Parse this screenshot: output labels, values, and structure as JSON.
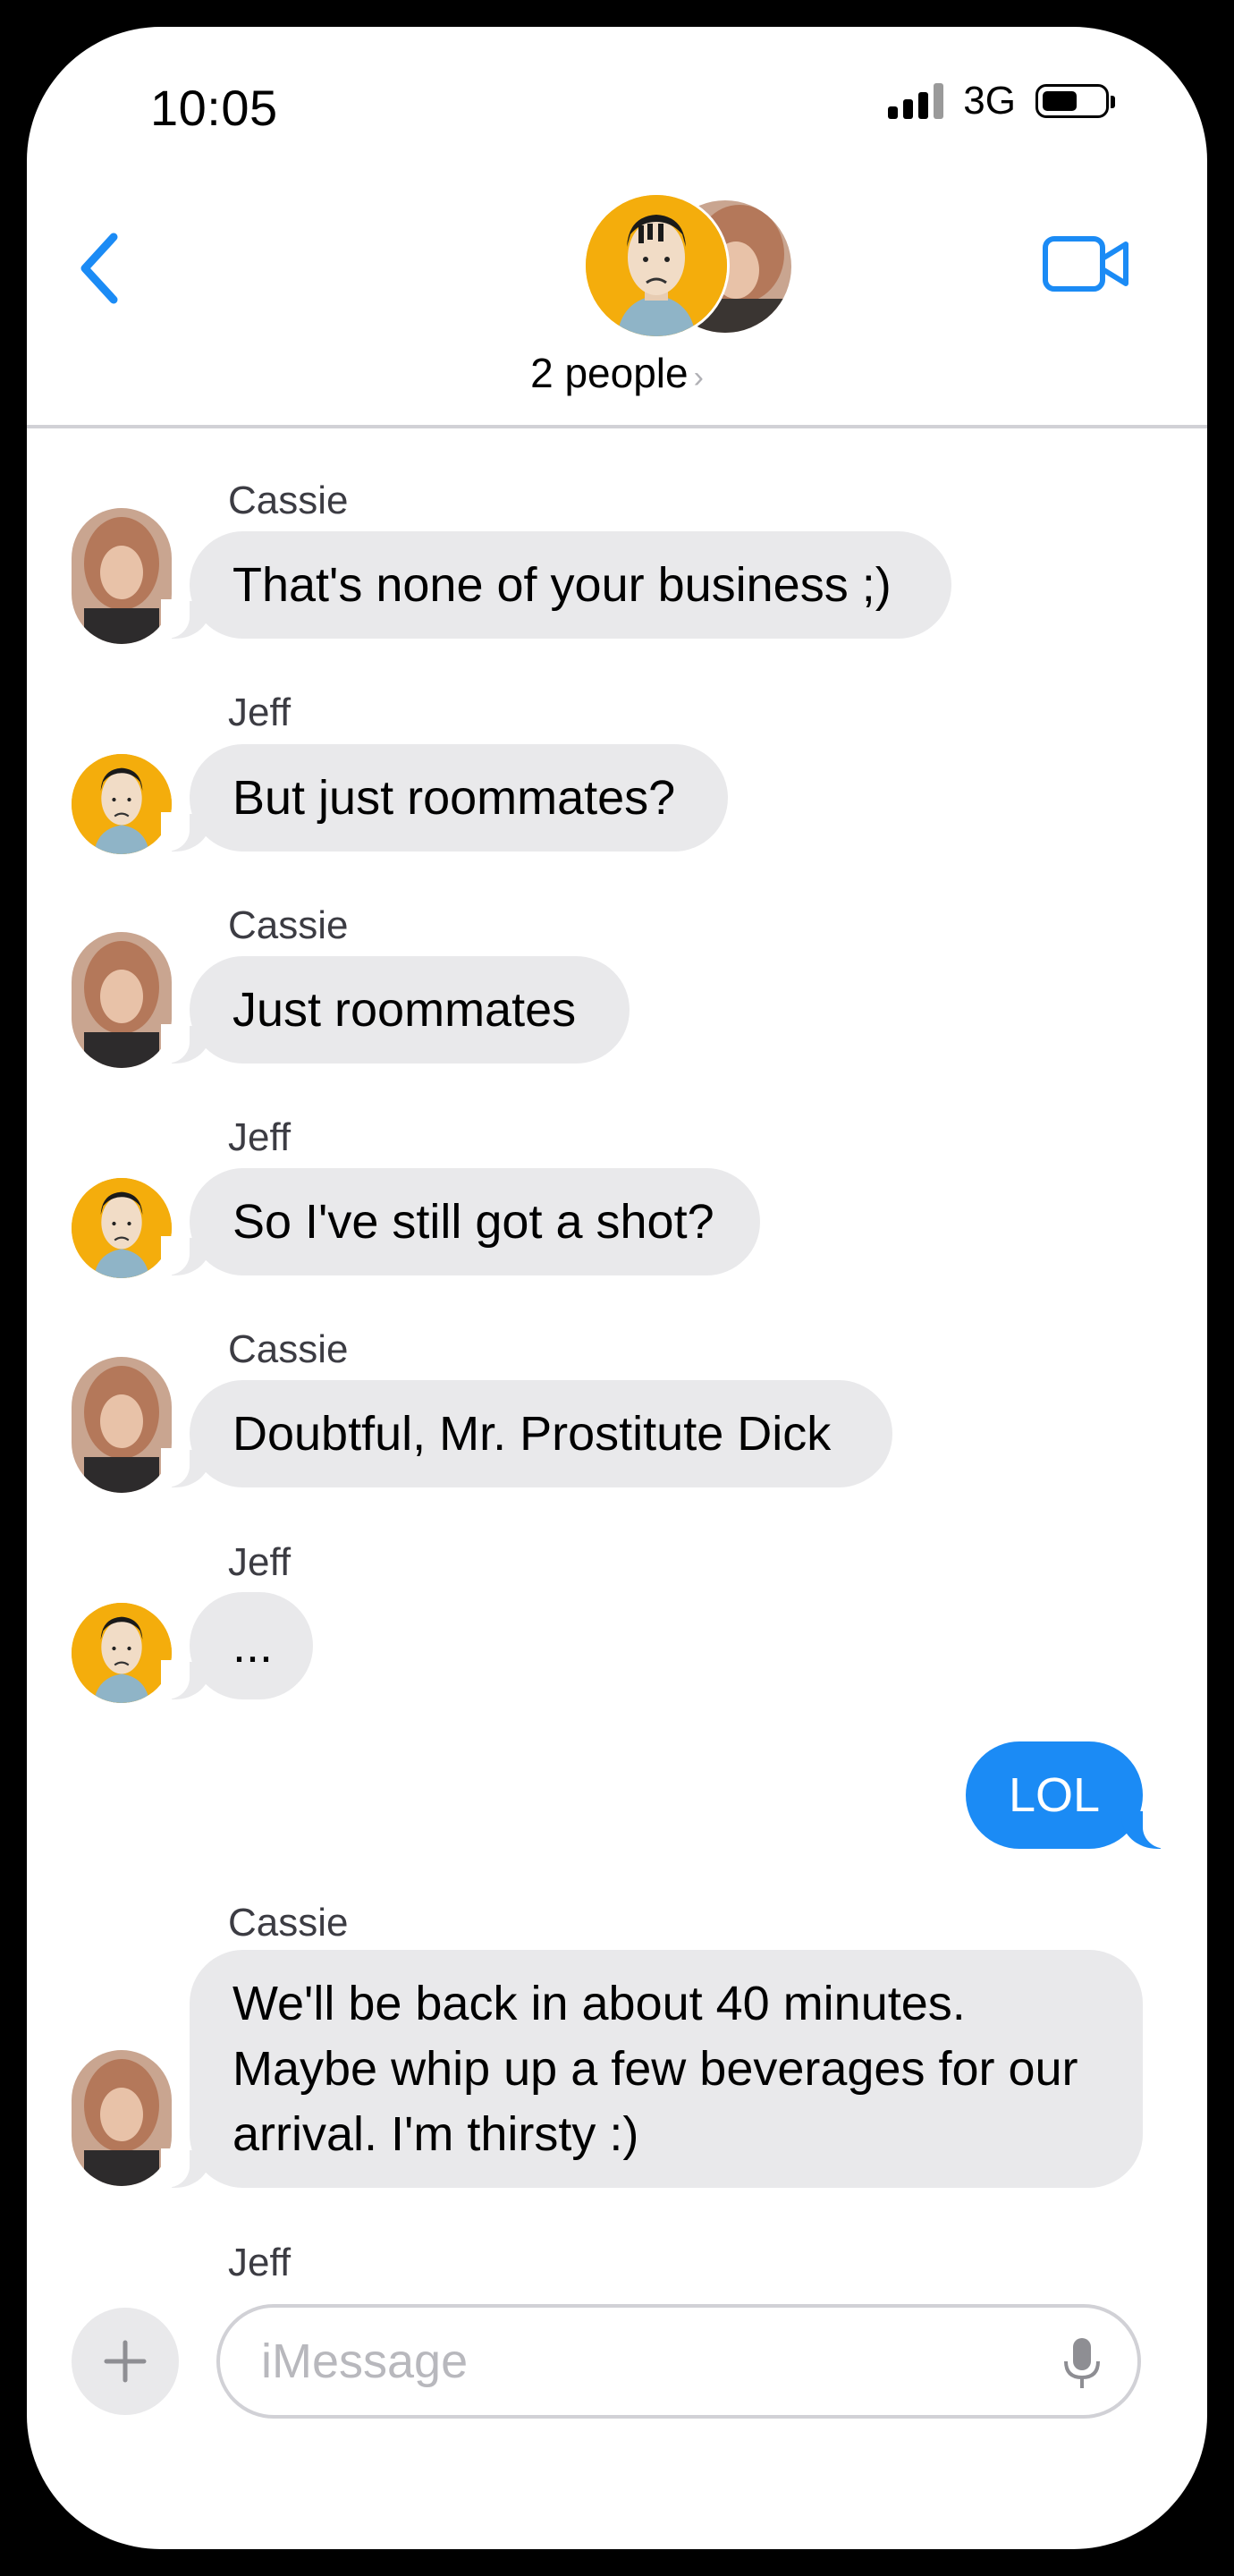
{
  "status_bar": {
    "time": "10:05",
    "network": "3G"
  },
  "header": {
    "group_label": "2 people",
    "chevron": "›"
  },
  "messages": [
    {
      "sender": "Cassie",
      "text": "That's none of your business ;)"
    },
    {
      "sender": "Jeff",
      "text": "But just roommates?"
    },
    {
      "sender": "Cassie",
      "text": "Just roommates"
    },
    {
      "sender": "Jeff",
      "text": "So I've still got a shot?"
    },
    {
      "sender": "Cassie",
      "text": "Doubtful, Mr. Prostitute Dick"
    },
    {
      "sender": "Jeff",
      "text": "..."
    },
    {
      "sender": "Me",
      "text": "LOL"
    },
    {
      "sender": "Cassie",
      "text": "We'll be back in about 40 minutes. Maybe whip up a few beverages for our arrival.  I'm thirsty :)"
    }
  ],
  "typing_sender": "Jeff",
  "composer": {
    "placeholder": "iMessage",
    "plus": "+"
  },
  "colors": {
    "accent": "#1b8bf5",
    "incoming_bubble": "#e9e9eb",
    "jeff_avatar": "#f4ad0c"
  },
  "icons": [
    "back-chevron-icon",
    "video-call-icon",
    "plus-icon",
    "microphone-icon",
    "signal-icon",
    "battery-icon"
  ]
}
